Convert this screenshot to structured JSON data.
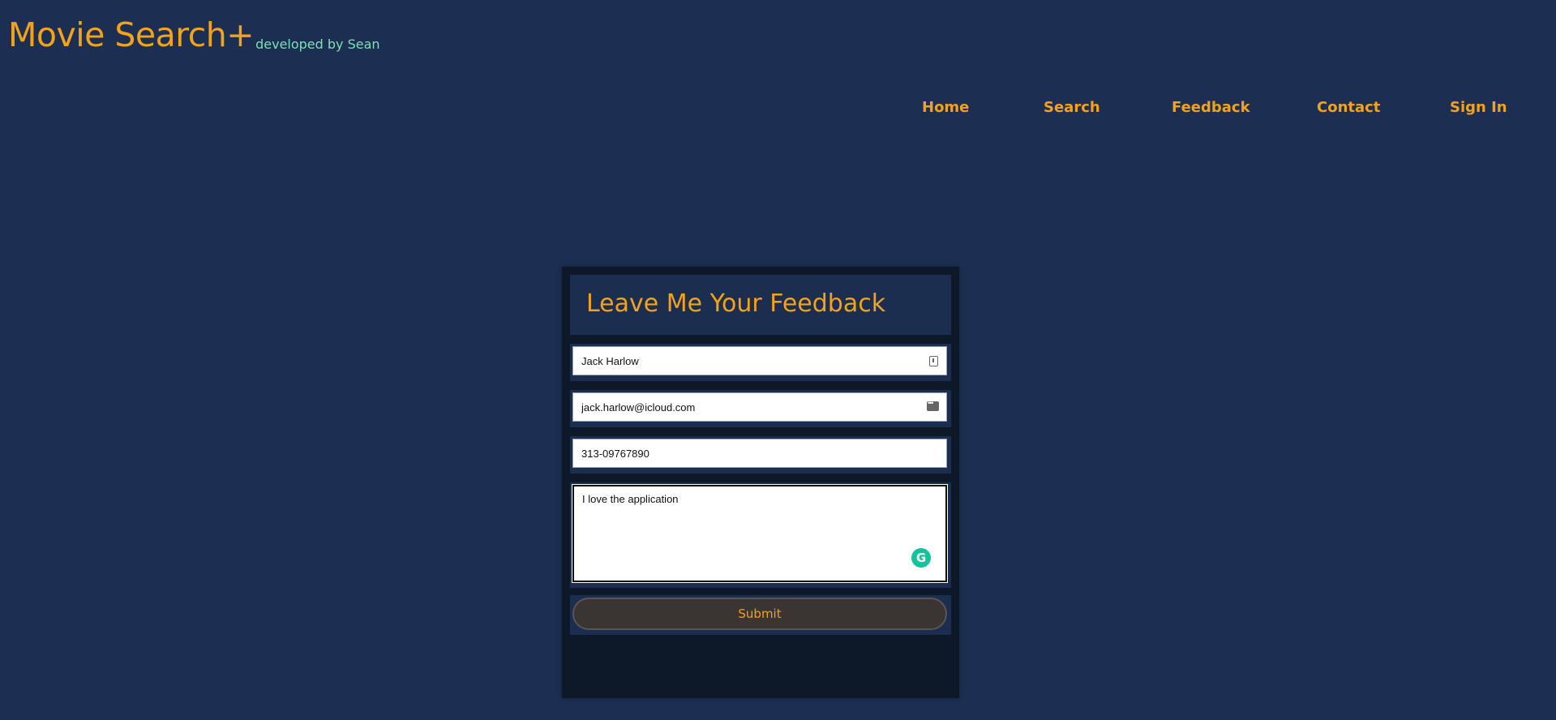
{
  "header": {
    "title": "Movie Search+",
    "subtitle": "developed by Sean"
  },
  "nav": {
    "items": [
      {
        "label": "Home"
      },
      {
        "label": "Search"
      },
      {
        "label": "Feedback"
      },
      {
        "label": "Contact"
      },
      {
        "label": "Sign In"
      }
    ]
  },
  "form": {
    "title": "Leave Me Your Feedback",
    "name_value": "Jack Harlow",
    "email_value": "jack.harlow@icloud.com",
    "phone_value": "313-09767890",
    "message_value": "I love the application",
    "submit_label": "Submit",
    "grammarly_letter": "G"
  },
  "colors": {
    "background": "#1c2f52",
    "accent": "#f3a21b",
    "subtitle": "#7ee0b4",
    "card": "#0d1829"
  }
}
